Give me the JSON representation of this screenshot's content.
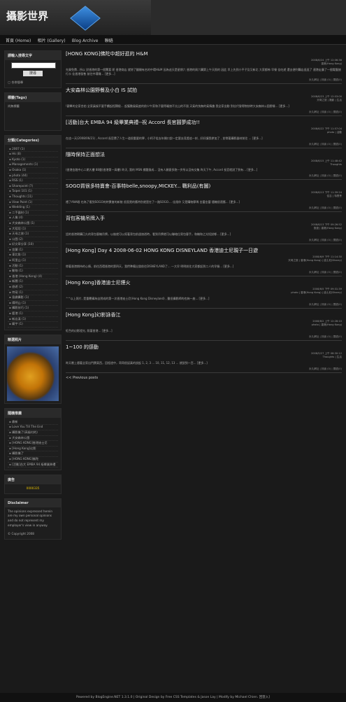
{
  "site": {
    "title": "攝影世界"
  },
  "nav": [
    "首頁 (Home)",
    "相片 (Gallery)",
    "Blog Archive",
    "聯絡"
  ],
  "search": {
    "title": "請輸入搜尋文字",
    "button": "搜尋",
    "checkbox": "合併搜尋"
  },
  "tags": {
    "title": "標籤(Tags)",
    "body": "尚無標籤"
  },
  "cats": {
    "title": "分類(Categories)",
    "items": [
      "2007 (1)",
      "Hk (8)",
      "Kyoto (1)",
      "Managements (1)",
      "Osaka (1)",
      "photo (44)",
      "RSS (1)",
      "Sharepoint (7)",
      "Taipei 101 (1)",
      "Thoughts (11)",
      "View Point (1)",
      "Wedding (1)",
      "二手器材 (1)",
      "人像 (4)",
      "大安森林公園 (1)",
      "大稻埕 (1)",
      "天母之旅 (1)",
      "公園 (2)",
      "好文章分享 (10)",
      "宜蘭 (1)",
      "東北角 (1)",
      "阿里山 (1)",
      "活動 (1)",
      "動物 (1)",
      "香港 (Hong Kong) (4)",
      "新聞 (1)",
      "旅遊 (2)",
      "特寫 (1)",
      "島嶼攝影 (1)",
      "陽明山 (1)",
      "攝影技巧 (1)",
      "鹿港 (1)",
      "新店溪 (1)",
      "廟宇 (1)"
    ]
  },
  "photo": {
    "title": "精選照片"
  },
  "recent": {
    "title": "隨機推薦",
    "items": [
      "最新",
      "Love You Till The End",
      "攝影機了(高級村的)",
      "大安森林公園",
      "[HONG KONG]香港迪士尼",
      "[Hong Kong]幻影",
      "攝影機了",
      "[HONG KONG]佛陀",
      "[活動]台大 EMBA 94 級畢業典禮"
    ]
  },
  "ads": {
    "title": "廣告",
    "counter": "0000335"
  },
  "disclaimer": {
    "title": "Disclaimer",
    "text": "The opinions expressed herein are my own personal opinions and do not represent my employer's view in anyway.",
    "copy": "© Copyright 2008"
  },
  "posts": [
    {
      "title": "[HONG KONG]佛陀中超好逛的 H&M",
      "date": "2008/6/24 上午 12:06:36",
      "tags": "香港(Hong Kong)",
      "body": "先買免費...所以 對香港的第一個驚喜 呢 香港商店 就除了翻開有名的中環H&M 因為這天是星期六 香港的周六購第上午天照的 因此 早上先到小平子及又新北 大家都佈 早餐 佳吃遊 還去便利購店逛逛了 連港走廣了一個電腦旅行卡 佳香港發售 前往中環囉...  [更多...]"
    },
    {
      "title": "大安森林公園野餐及小白 IS 試拍",
      "date": "2008/6/23 上午 12:03:00",
      "tags": "天母之旅 | 攝影 | 生活",
      "body": "!觀畢的全家合拍 全家員候不要手續起程積極... 起獲動風氣度的前少午家和子要得颯旅不太山的不過 天氣的快無的氣情趣 我全家出動 到佳代發得物快時大安森林公園野餐... [更多...]"
    },
    {
      "title": "[活動]台大 EMBA 94 級畢業典禮--祝 Accord 長官圓夢成功!!",
      "date": "2008/6/22 下午 11:57:04",
      "tags": "photo | 活動",
      "body": "在這一天(2008/06/21) , Accord 長官費了人生一道很重要的學 , 小柯子從去年開口說一定要去見證這一刻 , 好好讓我參加了 , 並帶著攝影器材前往 ... [更多...]"
    },
    {
      "title": "隨時保持正面想法",
      "date": "2008/6/15 上午 11:48:42",
      "tags": "Thoughts",
      "body": "(香港金融中心二期大樓 88層)香港第一高樓) 昨天, 我的 MSN 標題換成... 沒有人願意多跑一步所以沒有交集 昨天下午, Accord 長官就說了到有... [更多...]"
    },
    {
      "title": "SOGO買很多特賣會-百事特belle,snoopy,MICKEY... 戰利品(有圖)",
      "date": "2008/6/13 下午 11:39:24",
      "tags": "佳吉 | 特賣會",
      "body": "禮了ANA眼 也為了看到SOGO的特賣會的新裝 很直覺的應特別就是在了一路SOGO.... 佳限你 又是購物節嗎 金蕾金蕾 隨機很適應... [更多...]"
    },
    {
      "title": "背包客機吊牌入手",
      "date": "2008/6/13 下午 09:26:52",
      "tags": "旅遊 | 香港(Hong Kong)",
      "body": "話約香港朝購已久的背包客機吊牌，以後就可以幫著背包前週旅遊時，看到吊牌就可以聯絡位背包客手，和機和之光短說哪... [更多...]"
    },
    {
      "title": "[Hong Kong] Day 4 2008-06-02 HONG KONG DISNEYLAND 香港迪士尼親子一日遊",
      "date": "2008/6/9 下午 11:14:30",
      "tags": "天母之旅 | 香港(Hong Kong) | 迪士尼(Disney)",
      "body": "帶著香港期待的心情，前往西環香港的第四天，我們準備出發前往DISNEYLAND了... 一大早 明明前往大家都起到二人的早餐... [更多...]"
    },
    {
      "title": "[Hong Kong]香港迪士尼煙火",
      "date": "2008/6/5 下午 09:31:39",
      "tags": "photo | 香港(Hong Kong) | 迪士尼(Disney)",
      "body": "^^以上照片, 是重覆攝為自然成的第一次香港迪士尼(Hong Kong Disneyland) , 雖但攝影師的也夠一座... [更多...]"
    },
    {
      "title": "[Hong Kong]幻影詠香江",
      "date": "2008/6/2 上午 12:28:10",
      "tags": "photo | 香港(Hong Kong)",
      "body": "紅色的幻影燈光, 照著香港... [更多...]"
    },
    {
      "title": "1~100 的感動",
      "date": "2008/5/27 上午 08:30:12",
      "tags": "Thoughts | 生活",
      "body": "昨天晚上隨著全家出門賣東西，回程途中，哥哥很認真的說起 1, 2, 3 ... 10, 11, 12, 13 ... 就說到一百... [更多...]"
    }
  ],
  "postfoot": "永久網址 | 評論 (0) | 閱讀(0)",
  "prev": "<< Previous posts",
  "footer": "Powered by BlogEngine.NET 1.3.1.0 | Original Design by Free CSS Templates & Jason Lay | Modify by Michael Chien. 回登入]"
}
